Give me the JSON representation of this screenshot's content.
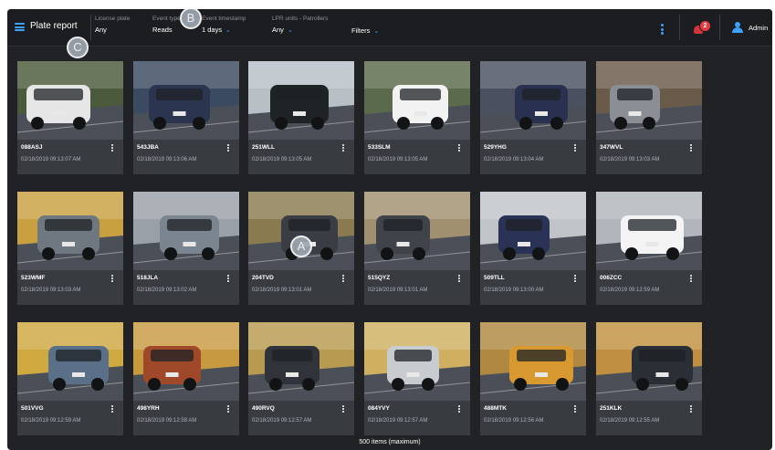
{
  "app": {
    "title": "Plate report"
  },
  "filters": [
    {
      "label": "License plate",
      "value": "Any",
      "has_chevron": false
    },
    {
      "label": "Event type",
      "value": "Reads",
      "has_chevron": false
    },
    {
      "label": "Event timestamp",
      "value": "1 days",
      "has_chevron": true
    },
    {
      "label": "LPR units - Patrollers",
      "value": "Any",
      "has_chevron": true
    }
  ],
  "toolbar": {
    "filters_label": "Filters"
  },
  "notifications": {
    "count": "2"
  },
  "user": {
    "name": "Admin"
  },
  "markers": [
    "A",
    "B",
    "C"
  ],
  "items": [
    {
      "plate": "088ASJ",
      "timestamp": "02/18/2019 09:13:07 AM",
      "car_color": "#e6e6e6",
      "scene": "#4a5a3a"
    },
    {
      "plate": "543JBA",
      "timestamp": "02/18/2019 09:13:06 AM",
      "car_color": "#2c3550",
      "scene": "#3a4a60"
    },
    {
      "plate": "251WLL",
      "timestamp": "02/18/2019 09:13:05 AM",
      "car_color": "#1e2326",
      "scene": "#b8c0c6"
    },
    {
      "plate": "533SLM",
      "timestamp": "02/18/2019 09:13:05 AM",
      "car_color": "#f2f2f2",
      "scene": "#5a6a4a"
    },
    {
      "plate": "529YHG",
      "timestamp": "02/18/2019 09:13:04 AM",
      "car_color": "#2a3050",
      "scene": "#4a5060"
    },
    {
      "plate": "347WVL",
      "timestamp": "02/18/2019 09:13:03 AM",
      "car_color": "#8a8f96",
      "scene": "#6a5a4a"
    },
    {
      "plate": "523WMF",
      "timestamp": "02/18/2019 09:13:03 AM",
      "car_color": "#6f7880",
      "scene": "#c8a040"
    },
    {
      "plate": "518JLA",
      "timestamp": "02/18/2019 09:13:02 AM",
      "car_color": "#7a8590",
      "scene": "#9aa0a8"
    },
    {
      "plate": "204TVD",
      "timestamp": "02/18/2019 09:13:01 AM",
      "car_color": "#3a3d44",
      "scene": "#8a7a50"
    },
    {
      "plate": "515QYZ",
      "timestamp": "02/18/2019 09:13:01 AM",
      "car_color": "#40444a",
      "scene": "#a09070"
    },
    {
      "plate": "509TLL",
      "timestamp": "02/18/2019 09:13:00 AM",
      "car_color": "#2a3356",
      "scene": "#c0c4c8"
    },
    {
      "plate": "006ZCC",
      "timestamp": "02/18/2019 09:12:59 AM",
      "car_color": "#f4f4f4",
      "scene": "#b0b6bc"
    },
    {
      "plate": "501VVG",
      "timestamp": "02/18/2019 09:12:59 AM",
      "car_color": "#5a6f88",
      "scene": "#d0a840"
    },
    {
      "plate": "498YRH",
      "timestamp": "02/18/2019 09:12:58 AM",
      "car_color": "#a0482a",
      "scene": "#c89a40"
    },
    {
      "plate": "490RVQ",
      "timestamp": "02/18/2019 09:12:57 AM",
      "car_color": "#30343a",
      "scene": "#b89a50"
    },
    {
      "plate": "084YVY",
      "timestamp": "02/18/2019 09:12:57 AM",
      "car_color": "#c8ccd0",
      "scene": "#d0b060"
    },
    {
      "plate": "488MTK",
      "timestamp": "02/18/2019 09:12:56 AM",
      "car_color": "#d89a30",
      "scene": "#b08840"
    },
    {
      "plate": "251KLK",
      "timestamp": "02/18/2019 09:12:55 AM",
      "car_color": "#2a2f35",
      "scene": "#c09040"
    }
  ],
  "footer": {
    "count_text": "500 items (maximum)"
  }
}
